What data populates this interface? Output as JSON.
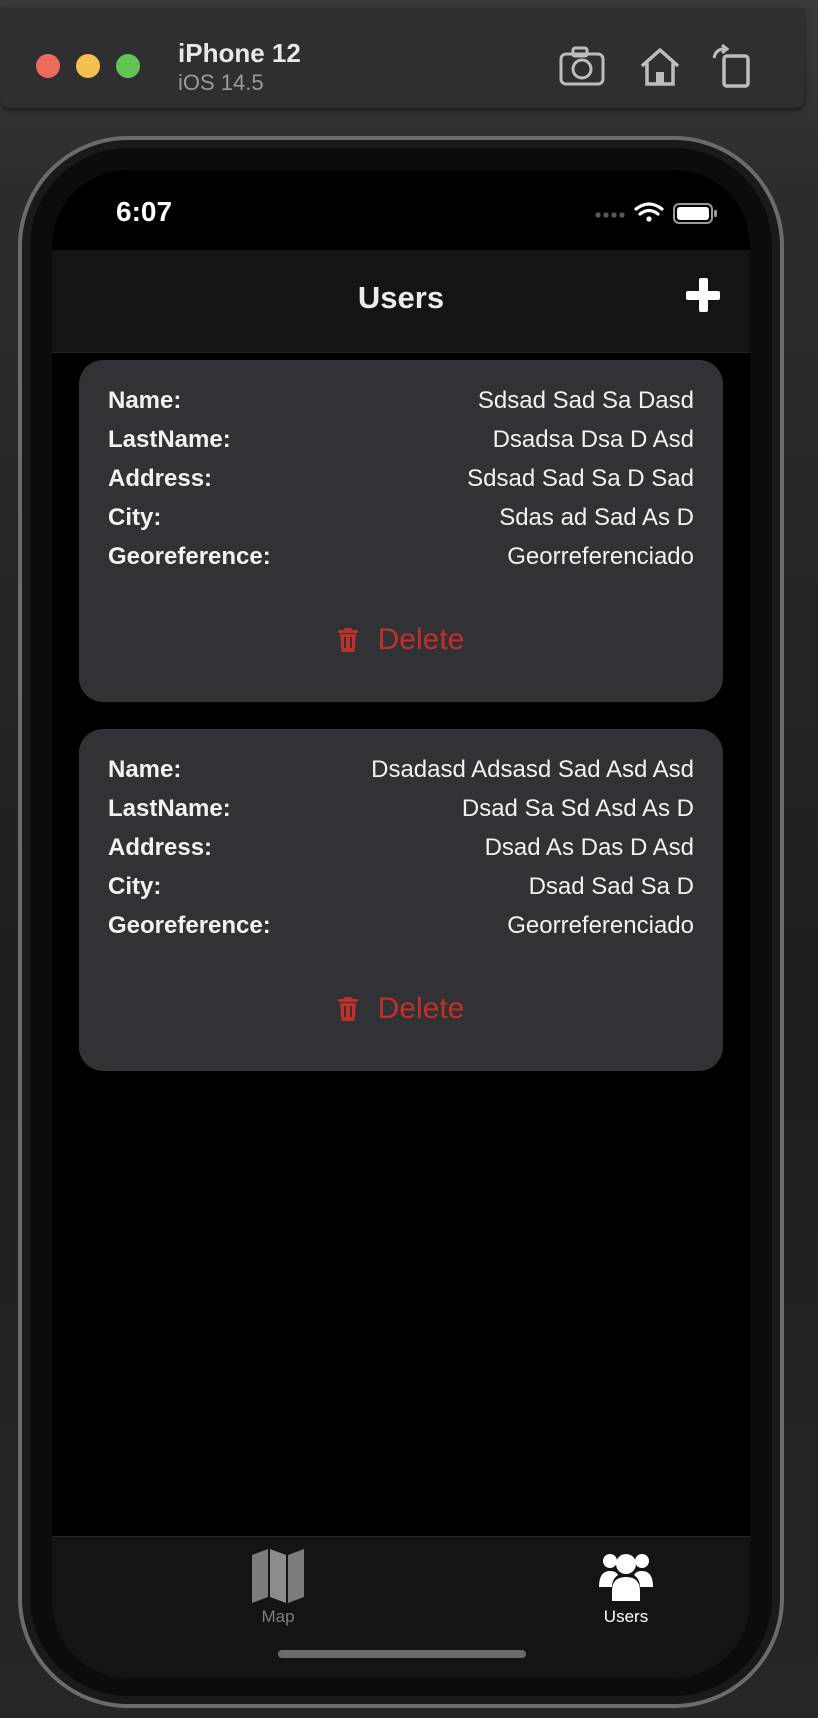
{
  "simulator": {
    "device_name": "iPhone 12",
    "os_version": "iOS 14.5",
    "buttons": [
      {
        "name": "screenshot",
        "icon": "camera-icon"
      },
      {
        "name": "home",
        "icon": "home-icon"
      },
      {
        "name": "rotate",
        "icon": "rotate-icon"
      }
    ]
  },
  "status_bar": {
    "time": "6:07",
    "icons": [
      "signal-dots-icon",
      "wifi-icon",
      "battery-icon"
    ]
  },
  "nav": {
    "title": "Users",
    "add_icon": "plus-icon"
  },
  "users": [
    {
      "name_label": "Name:",
      "name": "Sdsad Sad Sa Dasd",
      "lastname_label": "LastName:",
      "lastname": "Dsadsa Dsa D Asd",
      "address_label": "Address:",
      "address": "Sdsad Sad Sa D Sad",
      "city_label": "City:",
      "city": "Sdas ad Sad As D",
      "geo_label": "Georeference:",
      "geo": "Georreferenciado",
      "delete_label": "Delete"
    },
    {
      "name_label": "Name:",
      "name": "Dsadasd Adsasd Sad Asd Asd",
      "lastname_label": "LastName:",
      "lastname": "Dsad Sa Sd Asd As D",
      "address_label": "Address:",
      "address": "Dsad As Das D Asd",
      "city_label": "City:",
      "city": "Dsad Sad Sa D",
      "geo_label": "Georeference:",
      "geo": "Georreferenciado",
      "delete_label": "Delete"
    }
  ],
  "tabs": [
    {
      "label": "Map",
      "icon": "map-icon",
      "active": false
    },
    {
      "label": "Users",
      "icon": "users-icon",
      "active": true
    }
  ],
  "colors": {
    "delete": "#c0302b",
    "card_bg": "#303236",
    "screen_bg": "#000000",
    "tab_active": "#ffffff",
    "tab_inactive": "#7c7c7e"
  }
}
